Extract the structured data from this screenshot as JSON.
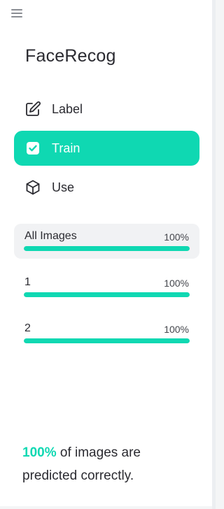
{
  "app": {
    "title": "FaceRecog",
    "menu_icon": "hamburger-menu-icon"
  },
  "nav": [
    {
      "label": "Label",
      "icon": "pencil-edit-icon",
      "active": false
    },
    {
      "label": "Train",
      "icon": "checkbox-checked-icon",
      "active": true
    },
    {
      "label": "Use",
      "icon": "cube-icon",
      "active": false
    }
  ],
  "stats": [
    {
      "name": "All Images",
      "percent_label": "100%",
      "progress": 1.0,
      "highlighted": true
    },
    {
      "name": "1",
      "percent_label": "100%",
      "progress": 1.0,
      "highlighted": false
    },
    {
      "name": "2",
      "percent_label": "100%",
      "progress": 1.0,
      "highlighted": false
    }
  ],
  "summary": {
    "accent_value": "100%",
    "text": " of images are predicted correctly."
  },
  "colors": {
    "accent": "#0fd8b2",
    "text": "#2a2a30",
    "panel_bg": "#ffffff",
    "highlight_bg": "#f1f2f4"
  }
}
